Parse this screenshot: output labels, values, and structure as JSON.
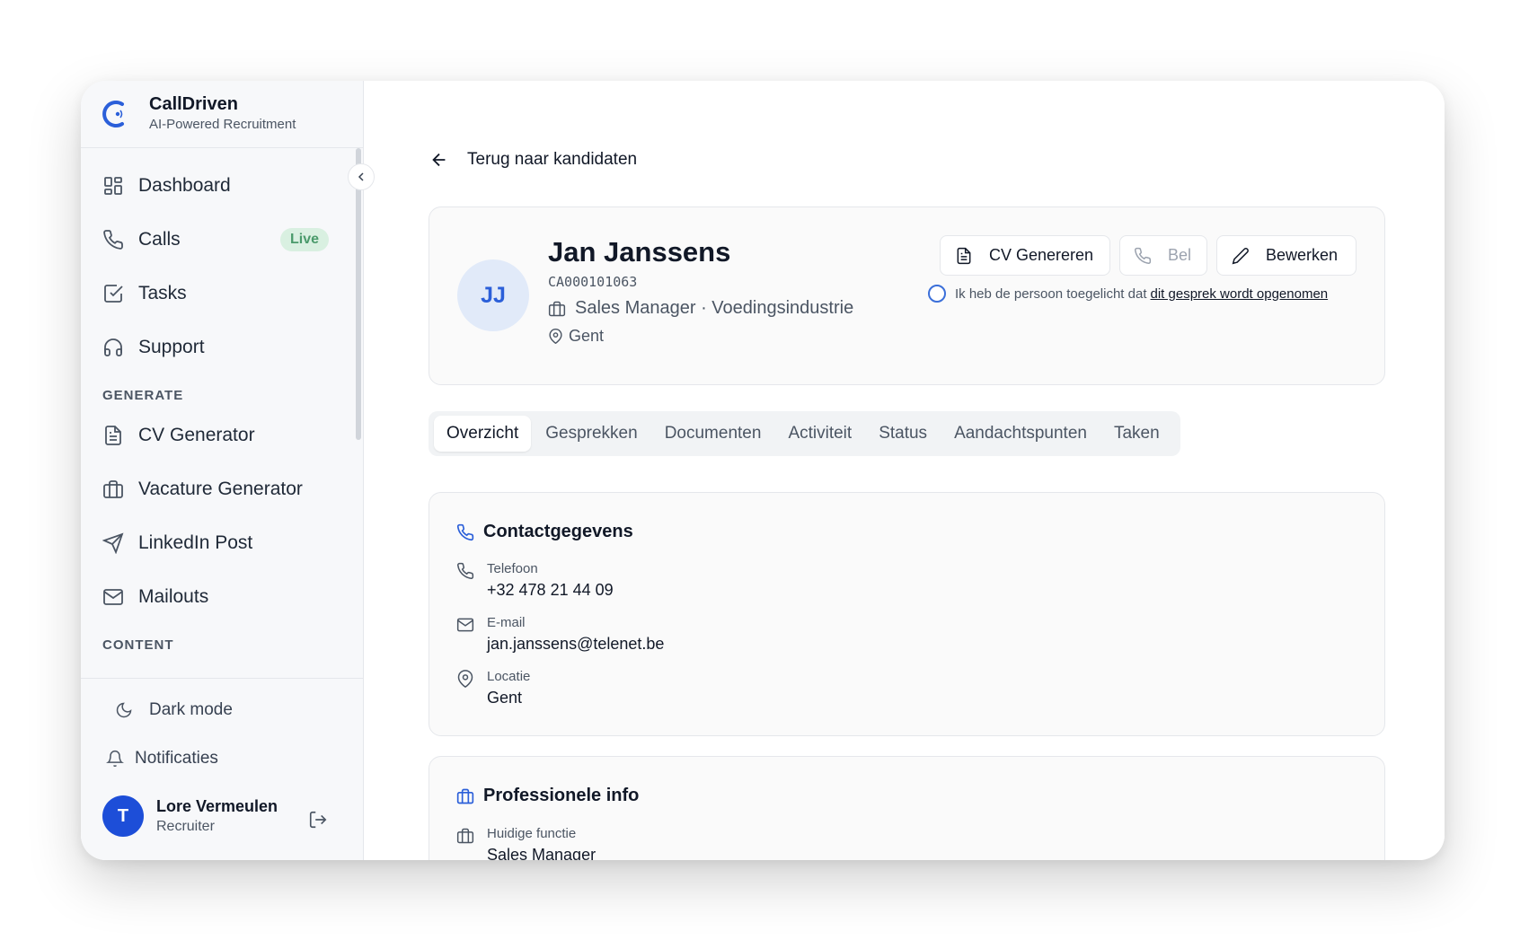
{
  "brand": {
    "name": "CallDriven",
    "tagline": "AI-Powered Recruitment"
  },
  "sidebar": {
    "items": [
      {
        "label": "Dashboard",
        "icon": "dashboard-icon"
      },
      {
        "label": "Calls",
        "icon": "phone-icon",
        "badge": "Live"
      },
      {
        "label": "Tasks",
        "icon": "check-square-icon"
      },
      {
        "label": "Support",
        "icon": "headphones-icon"
      }
    ],
    "generate_title": "GENERATE",
    "generate_items": [
      {
        "label": "CV Generator",
        "icon": "file-text-icon"
      },
      {
        "label": "Vacature Generator",
        "icon": "briefcase-icon"
      },
      {
        "label": "LinkedIn Post",
        "icon": "send-icon"
      },
      {
        "label": "Mailouts",
        "icon": "mail-icon"
      }
    ],
    "content_title": "CONTENT",
    "dark_mode": "Dark mode",
    "notifications": "Notificaties",
    "user": {
      "initial": "T",
      "name": "Lore Vermeulen",
      "role": "Recruiter"
    }
  },
  "back_label": "Terug naar kandidaten",
  "candidate": {
    "initials": "JJ",
    "name": "Jan Janssens",
    "id": "CA000101063",
    "role": "Sales Manager · Voedingsindustrie",
    "location": "Gent"
  },
  "actions": {
    "cv": "CV Genereren",
    "call": "Bel",
    "edit": "Bewerken"
  },
  "consent": {
    "text": "Ik heb de persoon toegelicht dat",
    "link": "dit gesprek wordt opgenomen"
  },
  "tabs": [
    "Overzicht",
    "Gesprekken",
    "Documenten",
    "Activiteit",
    "Status",
    "Aandachtspunten",
    "Taken"
  ],
  "contact": {
    "title": "Contactgegevens",
    "phone_label": "Telefoon",
    "phone": "+32 478 21 44 09",
    "email_label": "E-mail",
    "email": "jan.janssens@telenet.be",
    "location_label": "Locatie",
    "location": "Gent"
  },
  "professional": {
    "title": "Professionele info",
    "function_label": "Huidige functie",
    "function": "Sales Manager"
  },
  "colors": {
    "accent": "#2b5fd9",
    "live_bg": "#d9f0e1",
    "live_text": "#4a9a6b"
  }
}
